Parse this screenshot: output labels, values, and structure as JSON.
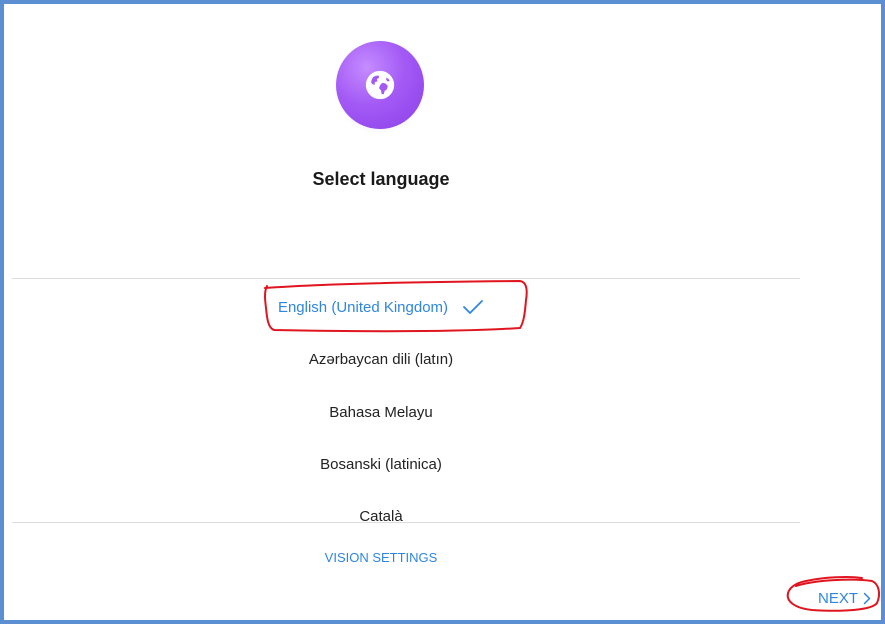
{
  "header": {
    "title": "Select language",
    "icon": "globe-icon"
  },
  "languages": [
    {
      "label": "English (United Kingdom)",
      "selected": true
    },
    {
      "label": "Azərbaycan dili (latın)",
      "selected": false
    },
    {
      "label": "Bahasa Melayu",
      "selected": false
    },
    {
      "label": "Bosanski (latinica)",
      "selected": false
    },
    {
      "label": "Català",
      "selected": false
    }
  ],
  "footer": {
    "vision_settings_label": "VISION SETTINGS",
    "next_label": "NEXT"
  },
  "colors": {
    "accent": "#2f86e0",
    "globe_purple": "#a35af5",
    "frame_border": "#5b8fd1",
    "annotation_red": "#e0151f"
  }
}
